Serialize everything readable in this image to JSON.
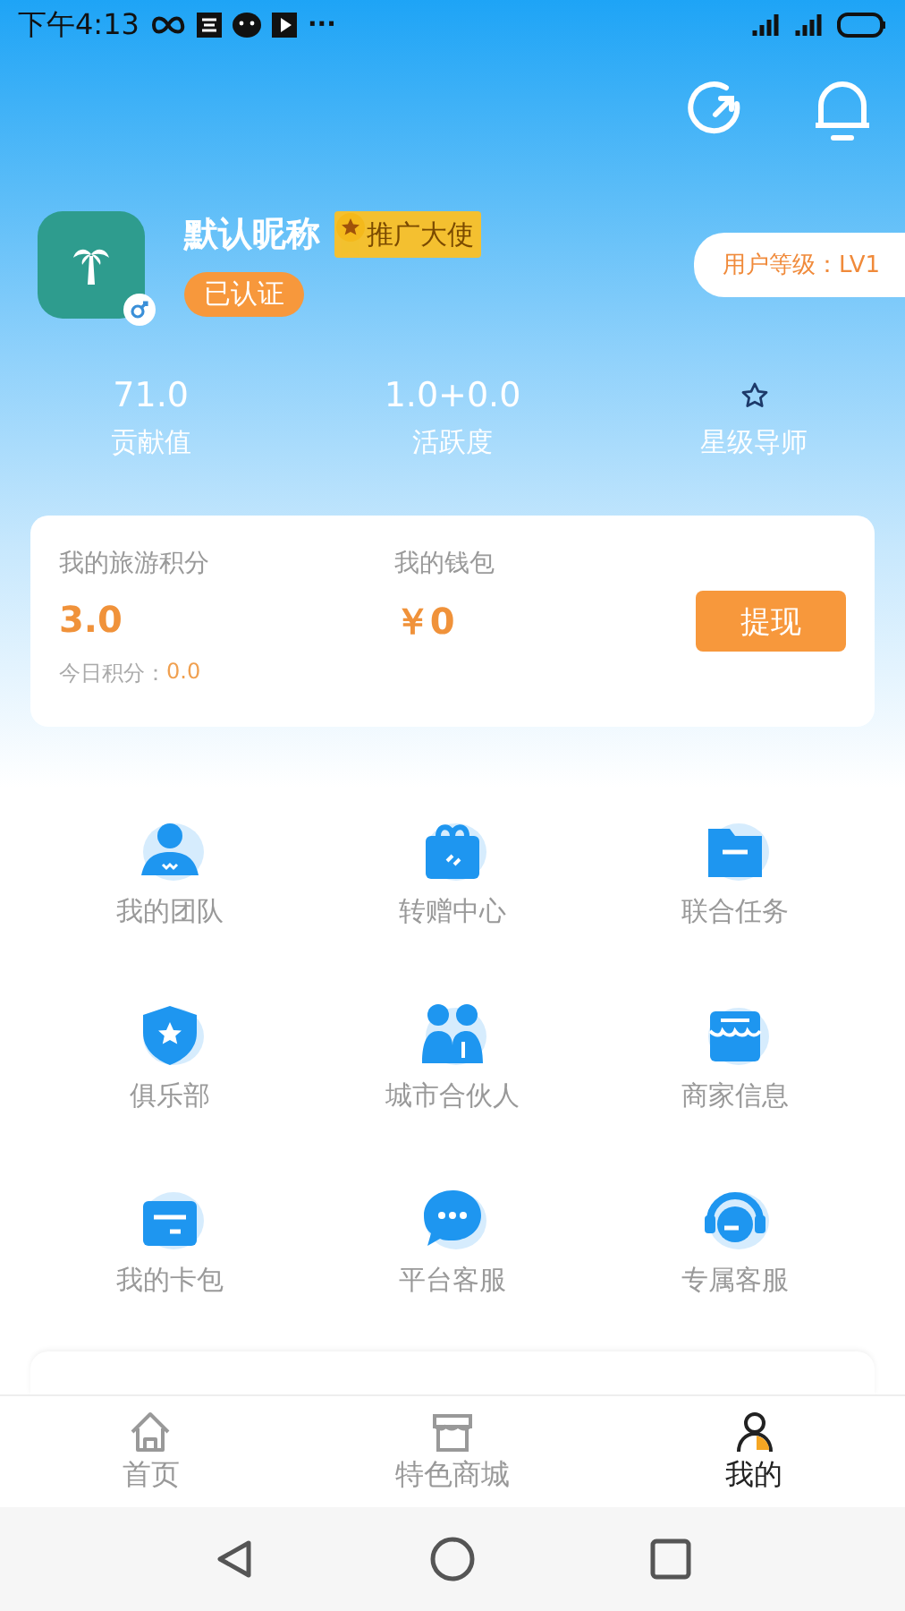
{
  "status_bar": {
    "time": "下午4:13",
    "more": "···"
  },
  "profile": {
    "nickname": "默认昵称",
    "badge": "推广大使",
    "verified": "已认证",
    "level": "用户等级：LV1"
  },
  "stats": [
    {
      "value": "71.0",
      "label": "贡献值"
    },
    {
      "value": "1.0+0.0",
      "label": "活跃度"
    },
    {
      "label": "星级导师"
    }
  ],
  "points_card": {
    "points_label": "我的旅游积分",
    "points": "3.0",
    "today_label": "今日积分：",
    "today": "0.0",
    "wallet_label": "我的钱包",
    "wallet": "￥0",
    "withdraw": "提现"
  },
  "menu": [
    {
      "label": "我的团队"
    },
    {
      "label": "转赠中心"
    },
    {
      "label": "联合任务"
    },
    {
      "label": "俱乐部"
    },
    {
      "label": "城市合伙人"
    },
    {
      "label": "商家信息"
    },
    {
      "label": "我的卡包"
    },
    {
      "label": "平台客服"
    },
    {
      "label": "专属客服"
    }
  ],
  "tabs": [
    {
      "label": "首页",
      "selected": false
    },
    {
      "label": "特色商城",
      "selected": false
    },
    {
      "label": "我的",
      "selected": true
    }
  ]
}
